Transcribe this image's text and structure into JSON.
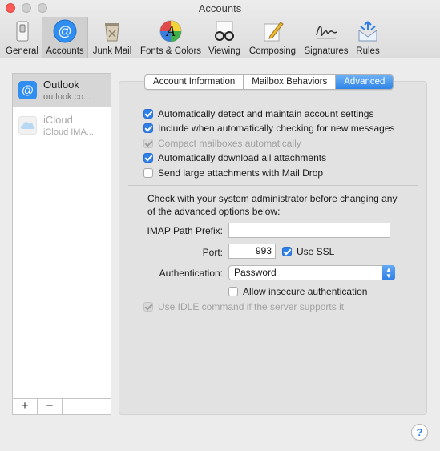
{
  "window": {
    "title": "Accounts"
  },
  "toolbar": {
    "items": [
      {
        "label": "General",
        "icon": "switch-icon"
      },
      {
        "label": "Accounts",
        "icon": "at-sign-icon",
        "selected": true
      },
      {
        "label": "Junk Mail",
        "icon": "trash-icon"
      },
      {
        "label": "Fonts & Colors",
        "icon": "fonts-colors-icon"
      },
      {
        "label": "Viewing",
        "icon": "glasses-icon"
      },
      {
        "label": "Composing",
        "icon": "pencil-icon"
      },
      {
        "label": "Signatures",
        "icon": "signature-icon"
      },
      {
        "label": "Rules",
        "icon": "rules-icon"
      }
    ]
  },
  "accounts": [
    {
      "name": "Outlook",
      "sub": "outlook.co...",
      "selected": true,
      "icon": "at-sign-icon"
    },
    {
      "name": "iCloud",
      "sub": "iCloud IMA...",
      "disabled": true,
      "icon": "cloud-icon"
    }
  ],
  "list_footer": {
    "add": "+",
    "remove": "−"
  },
  "tabs": [
    "Account Information",
    "Mailbox Behaviors",
    "Advanced"
  ],
  "active_tab": "Advanced",
  "options": [
    {
      "label": "Automatically detect and maintain account settings",
      "checked": true
    },
    {
      "label": "Include when automatically checking for new messages",
      "checked": true
    },
    {
      "label": "Compact mailboxes automatically",
      "checked": true,
      "disabled": true
    },
    {
      "label": "Automatically download all attachments",
      "checked": true
    },
    {
      "label": "Send large attachments with Mail Drop",
      "checked": false
    }
  ],
  "note": "Check with your system administrator before changing any of the advanced options below:",
  "imap": {
    "label": "IMAP Path Prefix:",
    "value": ""
  },
  "port": {
    "label": "Port:",
    "value": "993"
  },
  "ssl": {
    "label": "Use SSL",
    "checked": true
  },
  "auth": {
    "label": "Authentication:",
    "value": "Password"
  },
  "insecure": {
    "label": "Allow insecure authentication",
    "checked": false
  },
  "idle": {
    "label": "Use IDLE command if the server supports it",
    "checked": true,
    "disabled": true
  },
  "help": "?",
  "colors": {
    "accent": "#2f7fe8",
    "close": "#fc5b57",
    "selection": "#d6d6d6"
  }
}
